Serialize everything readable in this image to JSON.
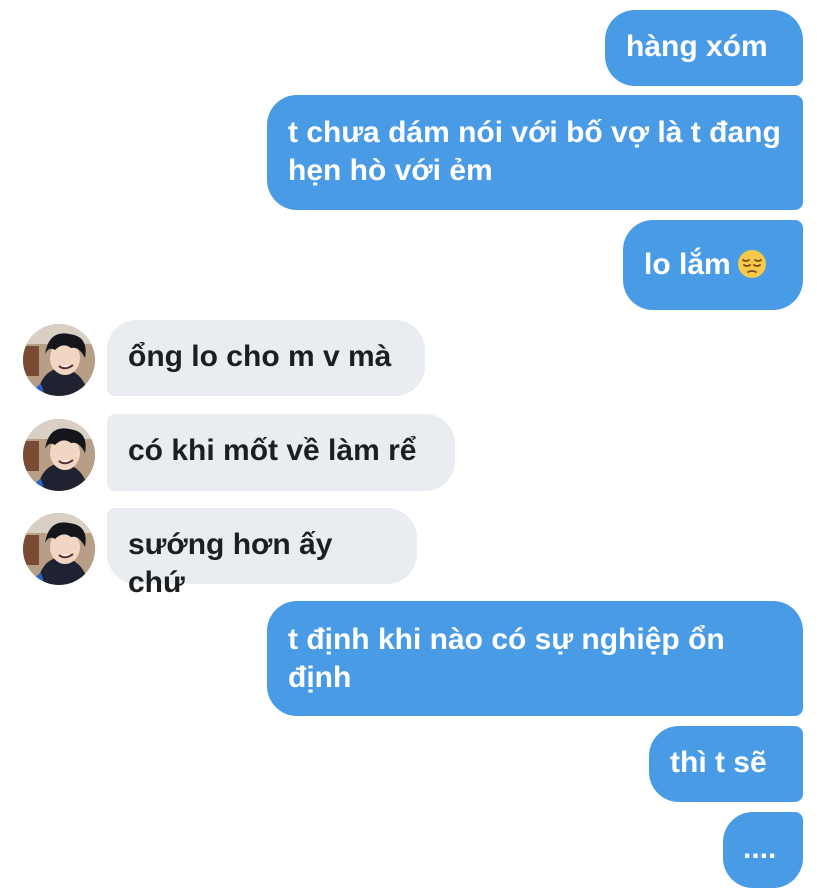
{
  "conversation": {
    "messages": [
      {
        "sender": "me",
        "text": "hàng xóm"
      },
      {
        "sender": "me",
        "text": "t chưa dám nói với bố vợ là t đang hẹn hò với ẻm"
      },
      {
        "sender": "me",
        "text": "lo lắm",
        "emoji": "pensive-face-icon"
      },
      {
        "sender": "them",
        "text": "ổng lo cho m v mà"
      },
      {
        "sender": "them",
        "text": "có khi mốt về làm rể"
      },
      {
        "sender": "them",
        "text": "sướng hơn ấy chứ"
      },
      {
        "sender": "me",
        "text": "t định khi nào có sự nghiệp ổn định"
      },
      {
        "sender": "me",
        "text": "thì t sẽ"
      },
      {
        "sender": "me",
        "text": "...."
      }
    ]
  },
  "colors": {
    "outgoing_bubble": "#4a9be6",
    "incoming_bubble": "#e9ecf0",
    "outgoing_text": "#ffffff",
    "incoming_text": "#1c1e21"
  }
}
